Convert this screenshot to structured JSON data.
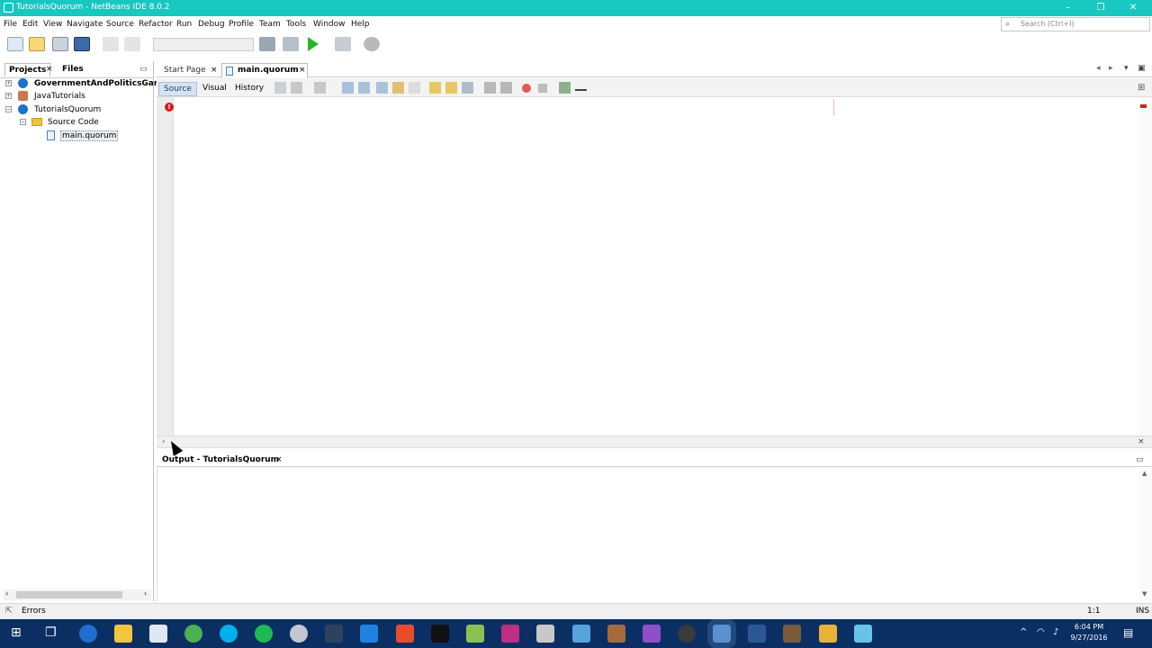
{
  "window": {
    "title": "TutorialsQuorum - NetBeans IDE 8.0.2",
    "minimize": "–",
    "restore": "❐",
    "close": "✕"
  },
  "menu": [
    "File",
    "Edit",
    "View",
    "Navigate",
    "Source",
    "Refactor",
    "Run",
    "Debug",
    "Profile",
    "Team",
    "Tools",
    "Window",
    "Help"
  ],
  "search": {
    "placeholder": "Search (Ctrl+I)"
  },
  "projects_pane": {
    "tabs": [
      "Projects",
      "Files"
    ],
    "tree": [
      {
        "label": "GovernmentAndPoliticsGame",
        "bold": true
      },
      {
        "label": "JavaTutorials"
      },
      {
        "label": "TutorialsQuorum"
      },
      {
        "label": "Source Code"
      },
      {
        "label": "main.quorum"
      }
    ]
  },
  "editor": {
    "tabs": [
      "Start Page",
      "main.quorum"
    ],
    "active_tab": "main.quorum",
    "modes": [
      "Source",
      "Visual",
      "History"
    ],
    "active_mode": "Source"
  },
  "output": {
    "tab": "Output - TutorialsQuorum"
  },
  "status": {
    "left": "Errors",
    "position": "1:1",
    "mode": "INS"
  },
  "clock": {
    "time": "6:04 PM",
    "date": "9/27/2016"
  },
  "colors": {
    "titlebar": "#18c7c0",
    "taskbar": "#0c2f63",
    "error": "#d51d1d"
  }
}
